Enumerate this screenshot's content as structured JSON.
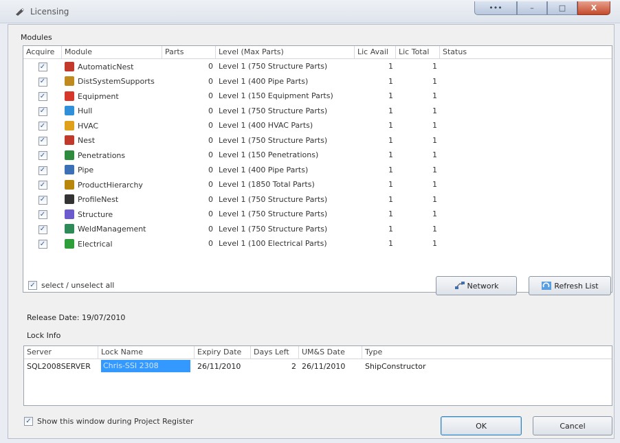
{
  "window": {
    "title": "Licensing",
    "buttons": {
      "first": "•••",
      "minimize": "–",
      "maximize": "□",
      "close": "X"
    }
  },
  "modules": {
    "section_label": "Modules",
    "columns": [
      "Acquire",
      "Module",
      "Parts",
      "Level (Max Parts)",
      "Lic Avail",
      "Lic Total",
      "Status"
    ],
    "rows": [
      {
        "name": "AutomaticNest",
        "icon": "automaticnest-icon",
        "icon_color": "#c0392b",
        "parts": "0",
        "level": "Level 1 (750 Structure Parts)",
        "avail": "1",
        "total": "1",
        "status": ""
      },
      {
        "name": "DistSystemSupports",
        "icon": "distsystemsupports-icon",
        "icon_color": "#c08a1e",
        "parts": "0",
        "level": "Level 1 (400 Pipe Parts)",
        "avail": "1",
        "total": "1",
        "status": ""
      },
      {
        "name": "Equipment",
        "icon": "equipment-icon",
        "icon_color": "#d6372b",
        "parts": "0",
        "level": "Level 1 (150 Equipment Parts)",
        "avail": "1",
        "total": "1",
        "status": ""
      },
      {
        "name": "Hull",
        "icon": "hull-icon",
        "icon_color": "#2f8fd8",
        "parts": "0",
        "level": "Level 1 (750 Structure Parts)",
        "avail": "1",
        "total": "1",
        "status": ""
      },
      {
        "name": "HVAC",
        "icon": "hvac-icon",
        "icon_color": "#e0a11a",
        "parts": "0",
        "level": "Level 1 (400 HVAC Parts)",
        "avail": "1",
        "total": "1",
        "status": ""
      },
      {
        "name": "Nest",
        "icon": "nest-icon",
        "icon_color": "#c0392b",
        "parts": "0",
        "level": "Level 1 (750 Structure Parts)",
        "avail": "1",
        "total": "1",
        "status": ""
      },
      {
        "name": "Penetrations",
        "icon": "penetrations-icon",
        "icon_color": "#2e8b3d",
        "parts": "0",
        "level": "Level 1 (150 Penetrations)",
        "avail": "1",
        "total": "1",
        "status": ""
      },
      {
        "name": "Pipe",
        "icon": "pipe-icon",
        "icon_color": "#3b6fb6",
        "parts": "0",
        "level": "Level 1 (400 Pipe Parts)",
        "avail": "1",
        "total": "1",
        "status": ""
      },
      {
        "name": "ProductHierarchy",
        "icon": "producthierarchy-icon",
        "icon_color": "#b8860b",
        "parts": "0",
        "level": "Level 1 (1850 Total Parts)",
        "avail": "1",
        "total": "1",
        "status": ""
      },
      {
        "name": "ProfileNest",
        "icon": "profilenest-icon",
        "icon_color": "#333333",
        "parts": "0",
        "level": "Level 1 (750 Structure Parts)",
        "avail": "1",
        "total": "1",
        "status": ""
      },
      {
        "name": "Structure",
        "icon": "structure-icon",
        "icon_color": "#6a5acd",
        "parts": "0",
        "level": "Level 1 (750 Structure Parts)",
        "avail": "1",
        "total": "1",
        "status": ""
      },
      {
        "name": "WeldManagement",
        "icon": "weldmanagement-icon",
        "icon_color": "#2e8b57",
        "parts": "0",
        "level": "Level 1 (750 Structure Parts)",
        "avail": "1",
        "total": "1",
        "status": ""
      },
      {
        "name": "Electrical",
        "icon": "electrical-icon",
        "icon_color": "#2e9e3a",
        "parts": "0",
        "level": "Level 1 (100 Electrical Parts)",
        "avail": "1",
        "total": "1",
        "status": ""
      }
    ]
  },
  "select_all_label": "select / unselect all",
  "network_button": "Network",
  "refresh_button": "Refresh List",
  "release_date": "Release Date: 19/07/2010",
  "lock_info": {
    "section_label": "Lock Info",
    "columns": [
      "Server",
      "Lock Name",
      "Expiry Date",
      "Days Left",
      "UM&S Date",
      "Type"
    ],
    "rows": [
      {
        "server": "SQL2008SERVER",
        "lock_name": "Chris-SSI 2308",
        "expiry": "26/11/2010",
        "days_left": "2",
        "ums_date": "26/11/2010",
        "type": "ShipConstructor"
      }
    ]
  },
  "show_window_label": "Show this window during Project Register",
  "ok_button": "OK",
  "cancel_button": "Cancel",
  "checkmark_glyph": "✓"
}
